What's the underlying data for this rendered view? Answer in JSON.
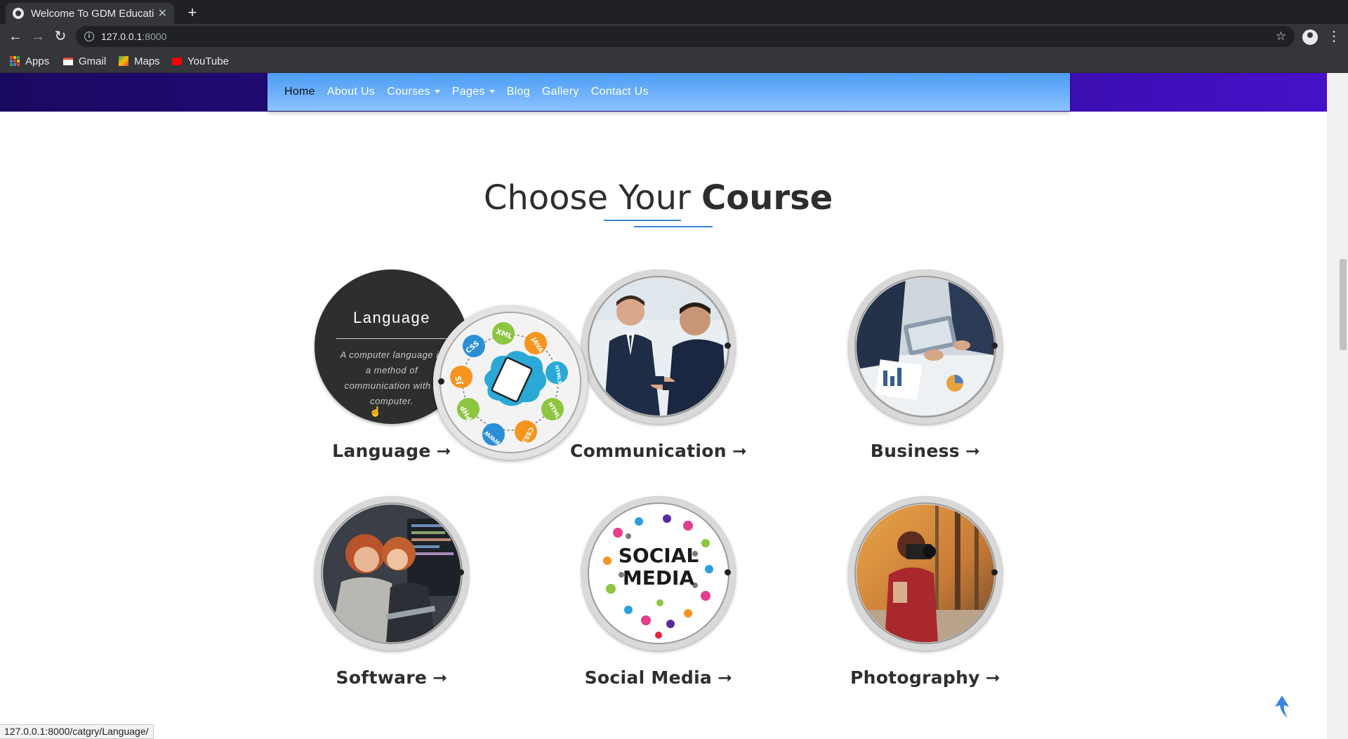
{
  "browser": {
    "tab_title": "Welcome To GDM Educati",
    "new_tab_label": "+",
    "url_host": "127.0.0.1",
    "url_port": ":8000",
    "bookmarks": [
      "Apps",
      "Gmail",
      "Maps",
      "YouTube"
    ],
    "status_url": "127.0.0.1:8000/catgry/Language/"
  },
  "nav": {
    "items": [
      {
        "label": "Home"
      },
      {
        "label": "About Us"
      },
      {
        "label": "Courses"
      },
      {
        "label": "Pages"
      },
      {
        "label": "Blog"
      },
      {
        "label": "Gallery"
      },
      {
        "label": "Contact Us"
      }
    ]
  },
  "section": {
    "title_light": "Choose Your ",
    "title_bold": "Course"
  },
  "courses": [
    {
      "label": "Language",
      "arrow": "➞"
    },
    {
      "label": "Communication",
      "arrow": "➞"
    },
    {
      "label": "Business",
      "arrow": "➞"
    },
    {
      "label": "Software",
      "arrow": "➞"
    },
    {
      "label": "Social Media",
      "arrow": "➞"
    },
    {
      "label": "Photography",
      "arrow": "➞"
    }
  ],
  "hover_card": {
    "title": "Language",
    "description": "A computer language is a method of communication with a computer."
  },
  "language_bubbles": [
    "CSS",
    "XML",
    "JAVA",
    "HTML5",
    "HTML",
    "CSS3",
    "WWW",
    "PHP",
    "JS"
  ],
  "social_media_text": [
    "SOCIAL",
    "MEDIA"
  ],
  "colors": {
    "nav_gradient_start": "#4a9cf5",
    "hero_band": "#2c0a8f",
    "accent": "#3a86e0"
  }
}
